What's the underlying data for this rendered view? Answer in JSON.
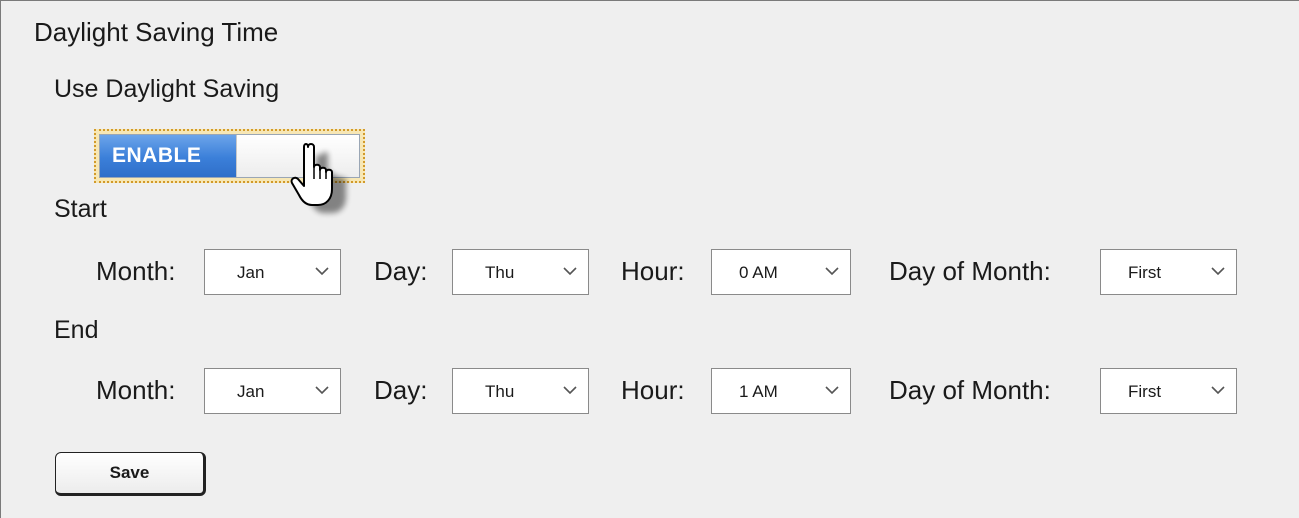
{
  "section": {
    "title": "Daylight Saving Time",
    "use_label": "Use Daylight Saving"
  },
  "toggle": {
    "label": "ENABLE",
    "state": "enabled",
    "accent_color": "#3b7fd9"
  },
  "cursor": {
    "icon": "hand-pointer-icon"
  },
  "start": {
    "label": "Start",
    "month_label": "Month:",
    "month_value": "Jan",
    "day_label": "Day:",
    "day_value": "Thu",
    "hour_label": "Hour:",
    "hour_value": "0 AM",
    "dom_label": "Day of Month:",
    "dom_value": "First"
  },
  "end": {
    "label": "End",
    "month_label": "Month:",
    "month_value": "Jan",
    "day_label": "Day:",
    "day_value": "Thu",
    "hour_label": "Hour:",
    "hour_value": "1 AM",
    "dom_label": "Day of Month:",
    "dom_value": "First"
  },
  "actions": {
    "save_label": "Save"
  }
}
